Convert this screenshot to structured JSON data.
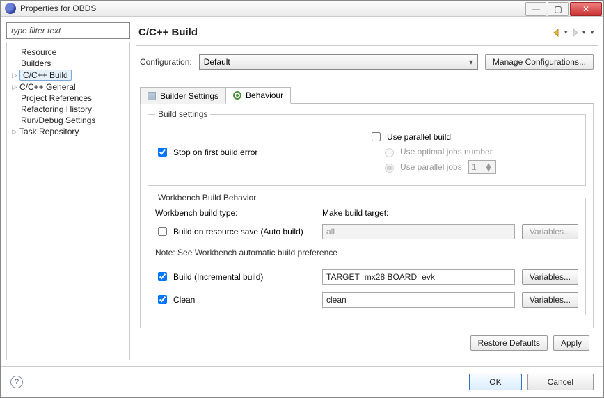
{
  "window": {
    "title": "Properties for OBDS"
  },
  "filter": {
    "placeholder": "type filter text"
  },
  "tree": {
    "items": [
      {
        "label": "Resource"
      },
      {
        "label": "Builders"
      },
      {
        "label": "C/C++ Build",
        "expandable": true
      },
      {
        "label": "C/C++ General",
        "expandable": true
      },
      {
        "label": "Project References"
      },
      {
        "label": "Refactoring History"
      },
      {
        "label": "Run/Debug Settings"
      },
      {
        "label": "Task Repository",
        "expandable": true
      }
    ]
  },
  "page": {
    "title": "C/C++ Build",
    "config_label": "Configuration:",
    "config_value": "Default",
    "manage_btn": "Manage Configurations...",
    "tabs": {
      "builder": "Builder Settings",
      "behaviour": "Behaviour"
    },
    "build_settings": {
      "legend": "Build settings",
      "stop_label": "Stop on first build error",
      "parallel_label": "Use parallel build",
      "optimal_label": "Use optimal jobs number",
      "jobs_label": "Use parallel jobs:",
      "jobs_value": "1"
    },
    "wb": {
      "legend": "Workbench Build Behavior",
      "type_header": "Workbench build type:",
      "target_header": "Make build target:",
      "autobuild_label": "Build on resource save (Auto build)",
      "autobuild_target": "all",
      "note": "Note: See Workbench automatic build preference",
      "incremental_label": "Build (Incremental build)",
      "incremental_target": "TARGET=mx28 BOARD=evk",
      "clean_label": "Clean",
      "clean_target": "clean",
      "variables_btn": "Variables..."
    },
    "restore_btn": "Restore Defaults",
    "apply_btn": "Apply"
  },
  "footer": {
    "ok": "OK",
    "cancel": "Cancel"
  }
}
